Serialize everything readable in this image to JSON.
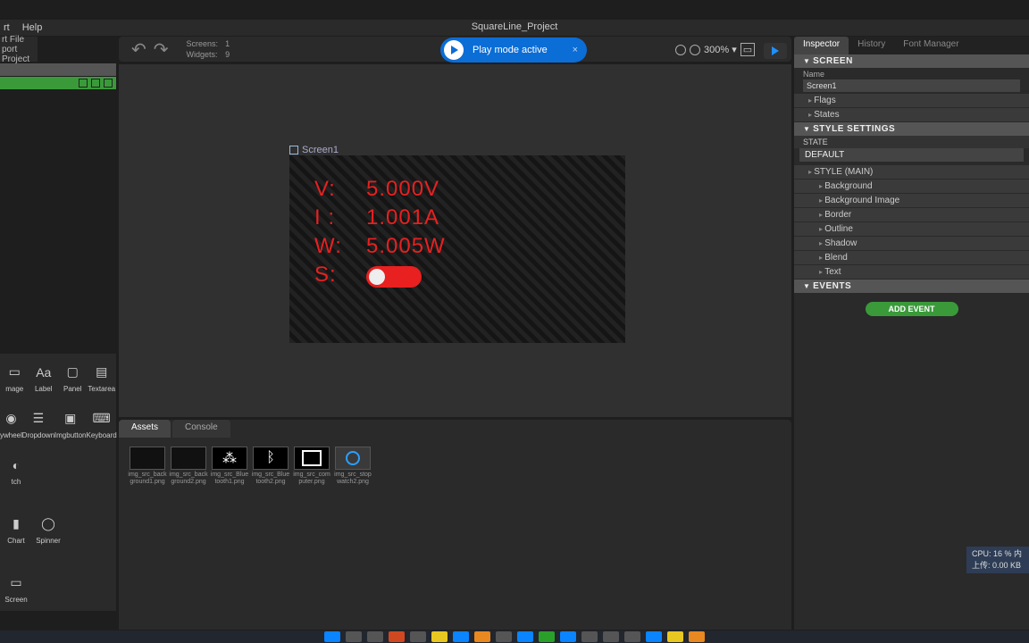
{
  "menu": {
    "item1": "rt",
    "item2": "Help"
  },
  "title": "SquareLine_Project",
  "project": {
    "line1": "rt File",
    "line2": "port Project"
  },
  "stats": {
    "screens_label": "Screens:",
    "screens": "1",
    "widgets_label": "Widgets:",
    "widgets": "9"
  },
  "play": {
    "label": "Play mode active",
    "close": "×"
  },
  "zoom": "300% ▾",
  "canvas": {
    "screen_tag": "Screen1",
    "rows": [
      {
        "label": "V:",
        "value": "5.000V"
      },
      {
        "label": "I :",
        "value": "1.001A"
      },
      {
        "label": "W:",
        "value": "5.005W"
      },
      {
        "label": "S:",
        "value": ""
      }
    ]
  },
  "palette": [
    [
      "mage",
      "Label",
      "Panel",
      "Textarea"
    ],
    [
      "ywheel",
      "Dropdown",
      "Imgbutton",
      "Keyboard"
    ],
    [
      "tch",
      "",
      "",
      ""
    ],
    [
      "Chart",
      "Spinner",
      "",
      ""
    ],
    [
      "Screen",
      "",
      "",
      ""
    ]
  ],
  "palette_icons": [
    [
      "▭",
      "Aa",
      "▢",
      "▤"
    ],
    [
      "◉",
      "☰",
      "▣",
      "⌨"
    ],
    [
      "◐",
      "",
      "",
      ""
    ],
    [
      "▮",
      "◯",
      "",
      ""
    ],
    [
      "▭",
      "",
      "",
      ""
    ]
  ],
  "assets": {
    "tabs": [
      "Assets",
      "Console"
    ],
    "items": [
      "img_src_background1.png",
      "img_src_background2.png",
      "img_src_Bluetooth1.png",
      "img_src_Bluetooth2.png",
      "img_src_computer.png",
      "img_src_stopwatch2.png"
    ]
  },
  "inspector": {
    "tabs": [
      "Inspector",
      "History",
      "Font Manager"
    ],
    "sections": {
      "screen": "SCREEN",
      "name_label": "Name",
      "name_value": "Screen1",
      "flags": "Flags",
      "states": "States",
      "style_settings": "STYLE SETTINGS",
      "state_label": "STATE",
      "state_value": "DEFAULT",
      "style_main": "STYLE (MAIN)",
      "style_items": [
        "Background",
        "Background Image",
        "Border",
        "Outline",
        "Shadow",
        "Blend",
        "Text"
      ],
      "events": "EVENTS",
      "add_event": "ADD EVENT"
    }
  },
  "cpu": {
    "line1": "CPU: 16 %    内",
    "line2": "上传: 0.00 KB"
  }
}
